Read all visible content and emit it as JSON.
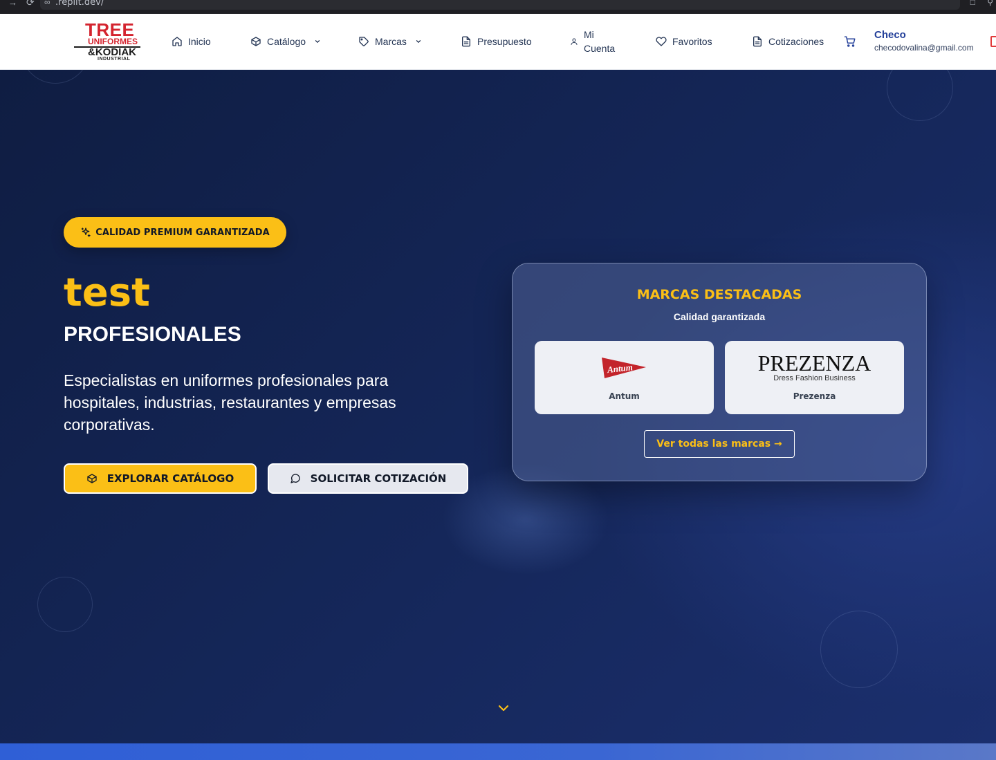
{
  "browser": {
    "url": ".replit.dev/",
    "back_icon": "→",
    "reload_icon": "⟳"
  },
  "header": {
    "logo": {
      "line1": "TREE",
      "line2": "UNIFORMES",
      "line3": "&KODIAK",
      "line4": "INDUSTRIAL"
    },
    "nav": {
      "inicio": "Inicio",
      "catalogo": "Catálogo",
      "marcas": "Marcas",
      "presupuesto": "Presupuesto",
      "cuenta_line1": "Mi",
      "cuenta_line2": "Cuenta",
      "favoritos": "Favoritos",
      "cotizaciones": "Cotizaciones"
    },
    "user": {
      "name": "Checo",
      "email": "checodovalina@gmail.com"
    }
  },
  "hero": {
    "badge": "CALIDAD PREMIUM GARANTIZADA",
    "title": "test",
    "subtitle": "PROFESIONALES",
    "description": "Especialistas en uniformes profesionales para hospitales, industrias, restaurantes y empresas corporativas.",
    "primary_button": "EXPLORAR CATÁLOGO",
    "secondary_button": "SOLICITAR COTIZACIÓN"
  },
  "brands": {
    "title": "MARCAS DESTACADAS",
    "subtitle": "Calidad garantizada",
    "items": [
      {
        "name": "Antum",
        "logo_text": "Antum"
      },
      {
        "name": "Prezenza",
        "logo_text": "PREZENZA",
        "logo_tagline": "Dress Fashion Business"
      }
    ],
    "view_all": "Ver todas las marcas →"
  },
  "colors": {
    "accent": "#fbbf16",
    "hero_bg": "#15275a",
    "nav_text": "#243554",
    "brand_red": "#d4242f"
  }
}
